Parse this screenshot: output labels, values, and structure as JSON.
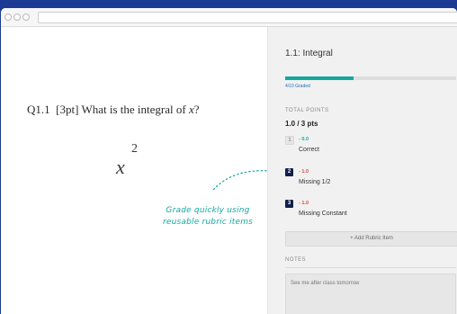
{
  "question": {
    "number": "Q1.1",
    "points": "[3pt]",
    "text": "What is the integral of",
    "variable": "x",
    "mark": "?"
  },
  "work": {
    "base": "x",
    "exponent": "2"
  },
  "annotation": {
    "line1": "Grade quickly using",
    "line2": "reusable rubric items"
  },
  "panel": {
    "title": "1.1: Integral",
    "progress": 0.4,
    "graded_label": "4/10 Graded",
    "total_points_label": "TOTAL POINTS",
    "total_points_value": "1.0 / 3 pts",
    "rubric_items": [
      {
        "key": "1",
        "points": "- 0.0",
        "label": "Correct",
        "selected": false
      },
      {
        "key": "2",
        "points": "- 1.0",
        "label": "Missing 1/2",
        "selected": true
      },
      {
        "key": "3",
        "points": "- 1.0",
        "label": "Missing Constant",
        "selected": true
      }
    ],
    "add_rubric_label": "+ Add Rubric Item",
    "notes_label": "NOTES",
    "notes_text": "See me after class tomorrow"
  },
  "colors": {
    "background": "#1b3a93",
    "accent": "#12a8a0",
    "deduction": "#d24a4a",
    "badge": "#0f1f4a"
  }
}
